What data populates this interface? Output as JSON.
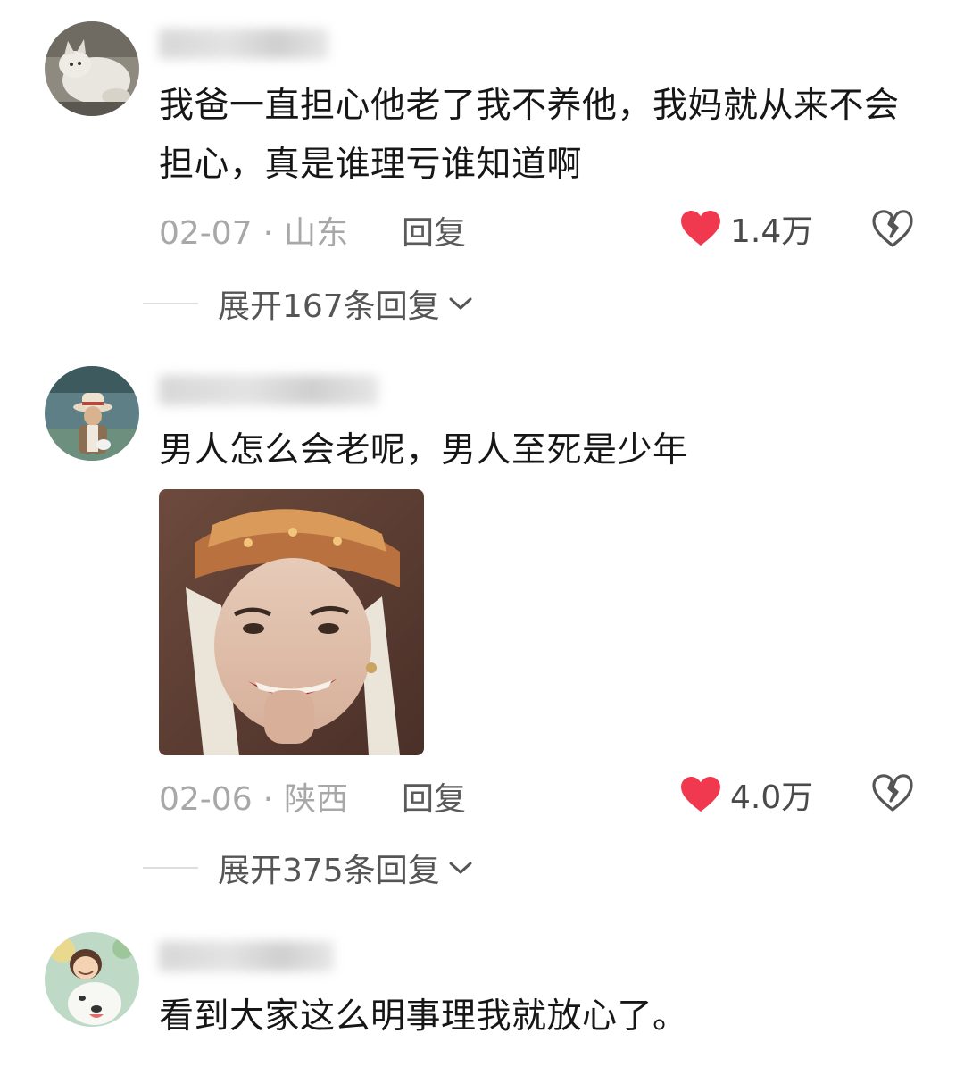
{
  "comments": [
    {
      "text": "我爸一直担心他老了我不养他，我妈就从来不会担心，真是谁理亏谁知道啊",
      "date": "02-07",
      "location": "山东",
      "reply_label": "回复",
      "likes": "1.4万",
      "expand_label": "展开167条回复",
      "avatar_icon": "cat-avatar"
    },
    {
      "text": "男人怎么会老呢，男人至死是少年",
      "date": "02-06",
      "location": "陕西",
      "reply_label": "回复",
      "likes": "4.0万",
      "expand_label": "展开375条回复",
      "avatar_icon": "hat-man-avatar",
      "image_icon": "tang-monk-meme-image"
    },
    {
      "text": "看到大家这么明事理我就放心了。",
      "avatar_icon": "dog-child-avatar"
    }
  ],
  "colors": {
    "like_heart": "#f0384f",
    "meta_gray": "#a8a8a8",
    "body_text": "#161616"
  },
  "icons": {
    "like": "heart-icon",
    "dislike": "broken-heart-icon",
    "expand": "chevron-down-icon"
  }
}
